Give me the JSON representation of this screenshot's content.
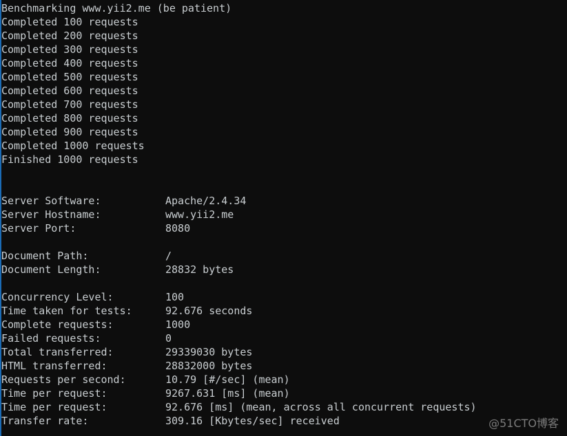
{
  "terminal": {
    "title": "ApacheBench benchmark output",
    "background_color": "#0d0d0d",
    "text_color": "#c9ced1",
    "left_edge_color": "#1b6bb5"
  },
  "progress": {
    "header": "Benchmarking www.yii2.me (be patient)",
    "lines": [
      "Completed 100 requests",
      "Completed 200 requests",
      "Completed 300 requests",
      "Completed 400 requests",
      "Completed 500 requests",
      "Completed 600 requests",
      "Completed 700 requests",
      "Completed 800 requests",
      "Completed 900 requests",
      "Completed 1000 requests",
      "Finished 1000 requests"
    ]
  },
  "server_info": [
    {
      "key": "Server Software:",
      "value": "Apache/2.4.34"
    },
    {
      "key": "Server Hostname:",
      "value": "www.yii2.me"
    },
    {
      "key": "Server Port:",
      "value": "8080"
    }
  ],
  "document_info": [
    {
      "key": "Document Path:",
      "value": "/"
    },
    {
      "key": "Document Length:",
      "value": "28832 bytes"
    }
  ],
  "results": [
    {
      "key": "Concurrency Level:",
      "value": "100"
    },
    {
      "key": "Time taken for tests:",
      "value": "92.676 seconds"
    },
    {
      "key": "Complete requests:",
      "value": "1000"
    },
    {
      "key": "Failed requests:",
      "value": "0"
    },
    {
      "key": "Total transferred:",
      "value": "29339030 bytes"
    },
    {
      "key": "HTML transferred:",
      "value": "28832000 bytes"
    },
    {
      "key": "Requests per second:",
      "value": "10.79 [#/sec] (mean)"
    },
    {
      "key": "Time per request:",
      "value": "9267.631 [ms] (mean)"
    },
    {
      "key": "Time per request:",
      "value": "92.676 [ms] (mean, across all concurrent requests)"
    },
    {
      "key": "Transfer rate:",
      "value": "309.16 [Kbytes/sec] received"
    }
  ],
  "watermark": {
    "text": "@51CTO博客"
  }
}
